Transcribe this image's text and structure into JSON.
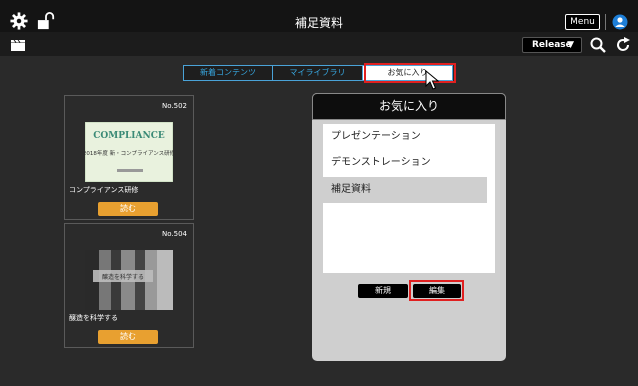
{
  "header": {
    "title": "補足資料",
    "menu_label": "Menu",
    "release_label": "Release"
  },
  "tabs": [
    {
      "label": "新着コンテンツ",
      "active": false
    },
    {
      "label": "マイライブラリ",
      "active": false
    },
    {
      "label": "お気に入り",
      "active": true
    }
  ],
  "cards": [
    {
      "number": "No.502",
      "caption": "コンプライアンス研修",
      "thumb_title": "COMPLIANCE",
      "thumb_text": "2018年度 新・コンプライアンス研修",
      "button": "読む"
    },
    {
      "number": "No.504",
      "caption": "醸造を科学する",
      "thumb_title": "",
      "thumb_text": "醸造を科学する",
      "button": "読む"
    }
  ],
  "favorites_panel": {
    "title": "お気に入り",
    "items": [
      {
        "label": "プレゼンテーション",
        "selected": false
      },
      {
        "label": "デモンストレーション",
        "selected": false
      },
      {
        "label": "補足資料",
        "selected": true
      }
    ],
    "new_label": "新規",
    "edit_label": "編集"
  },
  "colors": {
    "accent": "#37a7e0",
    "read_button": "#e8a030",
    "highlight": "#e02020"
  }
}
